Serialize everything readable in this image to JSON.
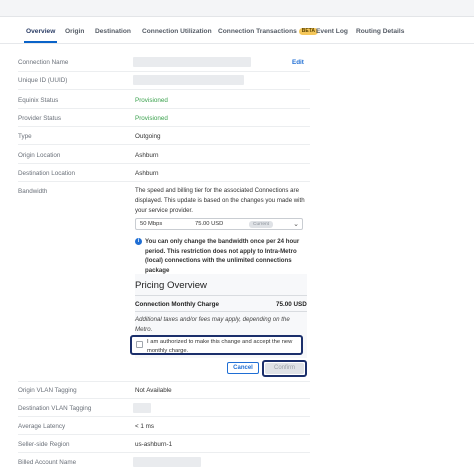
{
  "tabs": [
    {
      "label": "Overview"
    },
    {
      "label": "Origin"
    },
    {
      "label": "Destination"
    },
    {
      "label": "Connection Utilization"
    },
    {
      "label": "Connection Transactions",
      "badge": "BETA"
    },
    {
      "label": "Event Log"
    },
    {
      "label": "Routing Details"
    }
  ],
  "details": {
    "connection_name_label": "Connection Name",
    "edit_label": "Edit",
    "unique_id_label": "Unique ID (UUID)",
    "equinix_status_label": "Equinix Status",
    "equinix_status_value": "Provisioned",
    "provider_status_label": "Provider Status",
    "provider_status_value": "Provisioned",
    "type_label": "Type",
    "type_value": "Outgoing",
    "origin_location_label": "Origin Location",
    "origin_location_value": "Ashburn",
    "destination_location_label": "Destination Location",
    "destination_location_value": "Ashburn",
    "bandwidth_label": "Bandwidth"
  },
  "bandwidth": {
    "description": "The speed and billing tier for the associated Connections are displayed. This update is based on the changes you made with your service provider.",
    "selected_speed": "50 Mbps",
    "selected_price": "75.00 USD",
    "current_badge": "Current",
    "info_text": "You can only change the bandwidth once per 24 hour period. This restriction does not apply to Intra-Metro (local) connections with the unlimited connections package"
  },
  "pricing": {
    "title": "Pricing Overview",
    "charge_label": "Connection Monthly Charge",
    "charge_amount": "75.00 USD",
    "note": "Additional taxes and/or fees may apply, depending on the Metro.",
    "authorize_text": "I am authorized to make this change and accept the new monthly charge.",
    "authorize_checked": false,
    "cancel_label": "Cancel",
    "confirm_label": "Confirm"
  },
  "more_details": {
    "origin_vlan_label": "Origin VLAN Tagging",
    "origin_vlan_value": "Not Available",
    "destination_vlan_label": "Destination VLAN Tagging",
    "latency_label": "Average Latency",
    "latency_value": "< 1 ms",
    "seller_region_label": "Seller-side Region",
    "seller_region_value": "us-ashburn-1",
    "billed_account_label": "Billed Account Name"
  },
  "colors": {
    "accent": "#1f6ed4",
    "status_green": "#3aa14d",
    "highlight_outline": "#1b2f6b",
    "beta_badge": "#f5c75a"
  }
}
